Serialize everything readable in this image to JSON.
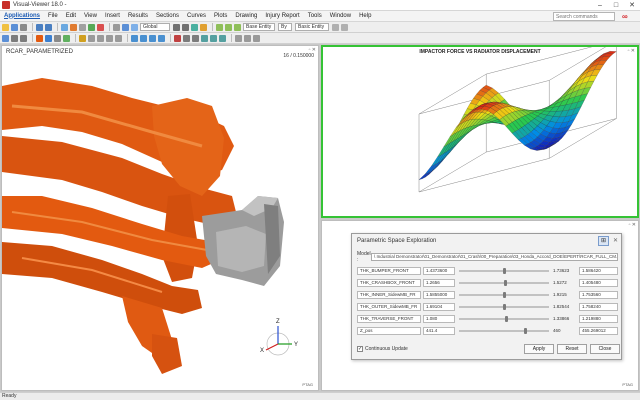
{
  "window": {
    "title": "Visual-Viewer 18.0 -",
    "controls": {
      "minimize": "–",
      "maximize": "□",
      "close": "✕"
    }
  },
  "menu": {
    "items": [
      "Applications",
      "File",
      "Edit",
      "View",
      "Insert",
      "Results",
      "Sections",
      "Curves",
      "Plots",
      "Drawing",
      "Injury Report",
      "Tools",
      "Window",
      "Help"
    ],
    "search_placeholder": "Search commands"
  },
  "toolbar": {
    "combo_global": "Global",
    "combo_base_entity": "Base Entity",
    "combo_by": "By",
    "combo_basic_entity": "Basic Entity"
  },
  "left_pane": {
    "label": "RCAR_PARAMETRIZED",
    "time": "16 / 0.150000",
    "triad_label": "PTAG"
  },
  "plot_pane": {
    "title": "IMPACTOR FORCE VS RADIATOR DISPLACEMENT"
  },
  "bottom_pane": {
    "triad_label": "PTAG"
  },
  "dialog": {
    "title": "Parametric Space Exploration",
    "model_label": "Model :",
    "model_path": "\\ Industrial Demonstrator\\01_Demonstrator\\01_Crash\\00_Preparation\\03_Honda_Accord_DOE\\EPERT\\RCAR_FULL_CM.epr?",
    "params": [
      {
        "name": "THK_BUMPER_FRONT",
        "min": "1.4373600",
        "max": "1.73623",
        "value": "1.586420",
        "fraction": 0.5
      },
      {
        "name": "THK_CRASHBOX_FRONT",
        "min": "1.2656",
        "max": "1.5272",
        "value": "1.405480",
        "fraction": 0.52
      },
      {
        "name": "THK_INNER_SidewMB_FR",
        "min": "1.5855000",
        "max": "1.9215",
        "value": "1.753560",
        "fraction": 0.5
      },
      {
        "name": "THK_OUTER_SidewMB_FR",
        "min": "1.69104",
        "max": "1.82544",
        "value": "1.758240",
        "fraction": 0.5
      },
      {
        "name": "THK_TRAVERSE_FRONT",
        "min": "1.080",
        "max": "1.33866",
        "value": "1.219880",
        "fraction": 0.53
      },
      {
        "name": "Z_pos",
        "min": "441.4",
        "max": "460",
        "value": "455.269012",
        "fraction": 0.75
      }
    ],
    "checkbox_label": "Continuous Update",
    "checkbox_checked": true,
    "apply": "Apply",
    "reset": "Reset",
    "close": "Close"
  },
  "status": {
    "text": "Ready"
  },
  "colors": {
    "car_orange": "#e35a10",
    "pane_active_border": "#35c335",
    "menu_active": "#1c5bb4",
    "brand_red": "#d4262b"
  }
}
